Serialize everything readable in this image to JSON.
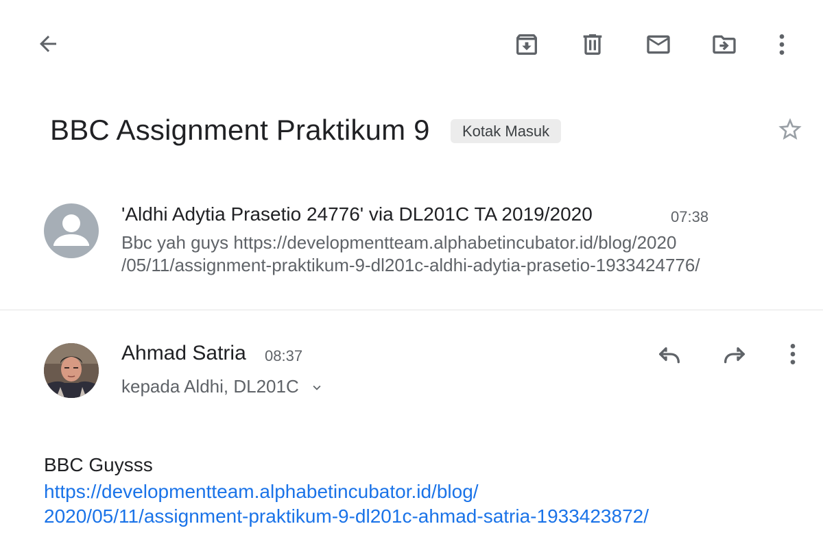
{
  "toolbar": {
    "back_icon": "arrow-left-icon",
    "archive_icon": "archive-icon",
    "delete_icon": "trash-icon",
    "mark_unread_icon": "mail-icon",
    "move_icon": "move-to-folder-icon",
    "more_icon": "more-vert-icon"
  },
  "email": {
    "subject": "BBC Assignment Praktikum 9",
    "label": "Kotak Masuk",
    "star_icon": "star-outline-icon"
  },
  "messages": [
    {
      "sender": "'Aldhi Adytia Prasetio 24776' via DL201C TA 2019/2020",
      "time": "07:38",
      "snippet_line1": "Bbc yah guys https://developmentteam.alphabetincubator.id/blog/2020",
      "snippet_line2": "/05/11/assignment-praktikum-9-dl201c-aldhi-adytia-prasetio-1933424776/",
      "avatar_icon": "person-icon"
    },
    {
      "sender": "Ahmad Satria",
      "time": "08:37",
      "recipients": "kepada Aldhi, DL201C",
      "body_text": "BBC Guysss",
      "link_line1": "https://developmentteam.alphabetincubator.id/blog/",
      "link_line2": "2020/05/11/assignment-praktikum-9-dl201c-ahmad-satria-1933423872/",
      "reply_icon": "reply-icon",
      "forward_icon": "forward-icon",
      "more_icon": "more-vert-icon",
      "expand_icon": "chevron-down-icon"
    }
  ],
  "colors": {
    "link": "#1a73e8",
    "icon": "#5f6368",
    "chip_bg": "#ececec"
  }
}
